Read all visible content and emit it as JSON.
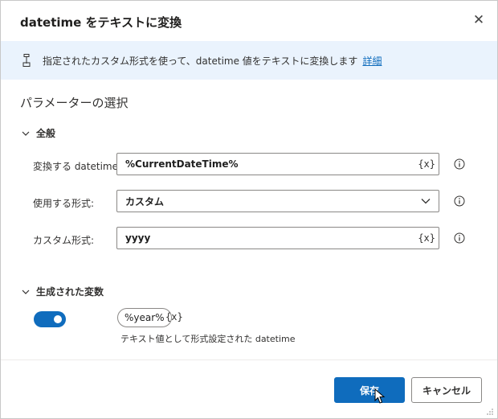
{
  "dialog": {
    "title": "datetime をテキストに変換",
    "close_glyph": "✕"
  },
  "info": {
    "text": "指定されたカスタム形式を使って、datetime 値をテキストに変換します",
    "link": "詳細",
    "icon": "action-icon"
  },
  "section_title": "パラメーターの選択",
  "general": {
    "header": "全般",
    "rows": [
      {
        "label": "変換する datetime:",
        "value": "%CurrentDateTime%",
        "suffix": "{x}"
      },
      {
        "label": "使用する形式:",
        "value": "カスタム"
      },
      {
        "label": "カスタム形式:",
        "value": "yyyy",
        "suffix": "{x}"
      }
    ]
  },
  "generated": {
    "header": "生成された変数",
    "toggle_on": true,
    "variable": "%year%",
    "variable_suffix": "{x}",
    "description": "テキスト値として形式設定された datetime"
  },
  "buttons": {
    "save": "保存",
    "cancel": "キャンセル"
  },
  "colors": {
    "accent": "#0f6cbd",
    "info_bg": "#eaf3fd"
  }
}
